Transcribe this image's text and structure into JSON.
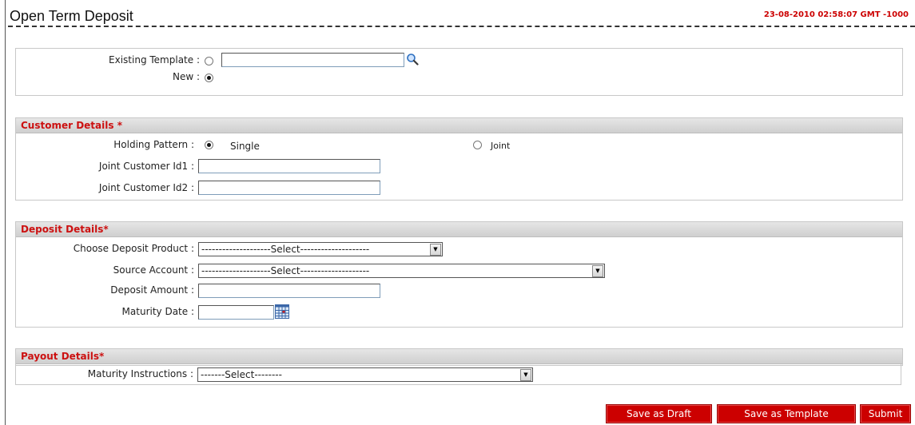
{
  "header": {
    "title": "Open Term Deposit",
    "timestamp": "23-08-2010 02:58:07 GMT -1000"
  },
  "template_section": {
    "existing_template_label": "Existing Template :",
    "existing_template_value": "",
    "existing_selected": false,
    "new_label": "New :",
    "new_selected": true
  },
  "customer_details": {
    "heading": "Customer Details",
    "required_mark": "*",
    "holding_pattern_label": "Holding Pattern :",
    "single_label": "Single",
    "single_selected": true,
    "joint_label": "Joint",
    "joint_selected": false,
    "joint_id1_label": "Joint Customer Id1 :",
    "joint_id1_value": "",
    "joint_id2_label": "Joint Customer Id2 :",
    "joint_id2_value": ""
  },
  "deposit_details": {
    "heading": "Deposit Details*",
    "product_label": "Choose Deposit Product :",
    "product_selected": "--------------------Select--------------------",
    "source_label": "Source Account :",
    "source_selected": "--------------------Select--------------------",
    "amount_label": "Deposit Amount :",
    "amount_value": "",
    "maturity_label": "Maturity Date :",
    "maturity_value": ""
  },
  "payout_details": {
    "heading": "Payout Details*",
    "instructions_label": "Maturity Instructions :",
    "instructions_selected": "-------Select--------"
  },
  "buttons": {
    "save_draft": "Save as Draft",
    "save_template": "Save as Template",
    "submit": "Submit"
  },
  "colors": {
    "accent": "#cc0000",
    "section_header_bg": "#d6d6d6"
  }
}
